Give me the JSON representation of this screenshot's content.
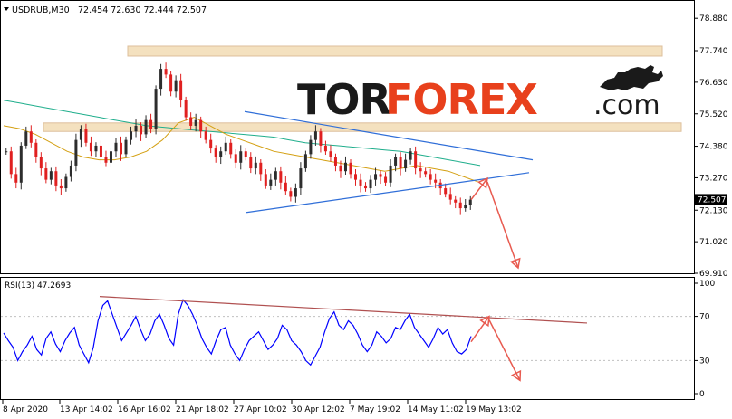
{
  "header": {
    "symbol": "USDRUB,M30",
    "ohlc": "72.454 72.630 72.444 72.507"
  },
  "watermark": {
    "part1": "TOR",
    "part2": "FOREX",
    "part3": ".com",
    "brand_color": "#e8401c",
    "dark_color": "#1a1a1a"
  },
  "indicator": {
    "label": "RSI(13) 47.2693"
  },
  "chart_data": [
    {
      "type": "candlestick",
      "ylim": [
        69.91,
        79.3
      ],
      "price_ticks": [
        "78.880",
        "77.740",
        "76.630",
        "75.520",
        "74.380",
        "73.270",
        "72.130",
        "71.020",
        "69.910"
      ],
      "price_tick_values": [
        78.88,
        77.74,
        76.63,
        75.52,
        74.38,
        73.27,
        72.13,
        71.02,
        69.91
      ],
      "current_price_label": "72.507",
      "current_price": 72.507,
      "x_labels": [
        "8 Apr 2020",
        "13 Apr 14:02",
        "16 Apr 16:02",
        "21 Apr 18:02",
        "27 Apr 10:02",
        "30 Apr 12:02",
        "7 May 19:02",
        "14 May 11:02",
        "19 May 13:02"
      ],
      "price_path": [
        74.2,
        73.4,
        73.1,
        74.4,
        74.9,
        74.5,
        74.0,
        73.6,
        73.2,
        73.5,
        73.0,
        72.9,
        73.3,
        73.7,
        74.6,
        75.0,
        74.5,
        74.2,
        74.4,
        74.0,
        73.8,
        74.2,
        74.5,
        74.1,
        74.6,
        74.9,
        75.1,
        74.8,
        75.3,
        75.0,
        76.4,
        77.1,
        76.9,
        76.3,
        76.7,
        76.0,
        75.4,
        75.1,
        75.3,
        74.9,
        74.6,
        74.3,
        74.0,
        74.2,
        74.5,
        74.1,
        73.8,
        74.2,
        74.0,
        73.6,
        73.8,
        73.4,
        73.0,
        73.2,
        73.5,
        73.1,
        72.8,
        72.6,
        72.9,
        73.6,
        74.1,
        74.6,
        74.9,
        74.4,
        74.2,
        74.0,
        73.7,
        73.5,
        73.8,
        73.4,
        73.2,
        73.0,
        72.9,
        73.2,
        73.4,
        73.3,
        73.1,
        73.7,
        74.0,
        73.6,
        73.9,
        74.2,
        73.6,
        73.5,
        73.4,
        73.2,
        73.1,
        72.9,
        72.7,
        72.5,
        72.4,
        72.2,
        72.3,
        72.5
      ],
      "moving_averages": [
        {
          "color": "#1fae8c",
          "values": [
            76.0,
            75.9,
            75.8,
            75.7,
            75.6,
            75.5,
            75.4,
            75.3,
            75.2,
            75.1,
            75.05,
            75.0,
            74.95,
            74.9,
            74.85,
            74.8,
            74.75,
            74.7,
            74.6,
            74.5,
            74.45,
            74.4,
            74.35,
            74.3,
            74.25,
            74.2,
            74.1,
            74.0,
            73.9,
            73.8,
            73.7
          ]
        },
        {
          "color": "#d4a013",
          "values": [
            75.1,
            75.0,
            74.8,
            74.5,
            74.2,
            74.0,
            73.9,
            73.9,
            74.0,
            74.2,
            74.6,
            75.2,
            75.4,
            75.1,
            74.8,
            74.6,
            74.4,
            74.2,
            74.1,
            74.0,
            73.9,
            73.8,
            73.7,
            73.6,
            73.5,
            73.6,
            73.7,
            73.6,
            73.5,
            73.3,
            73.1
          ]
        }
      ],
      "annotations": [
        {
          "kind": "resistance_zone",
          "y_low": 77.55,
          "y_high": 77.9
        },
        {
          "kind": "support_zone",
          "y_low": 74.9,
          "y_high": 75.2
        },
        {
          "kind": "trendline_upper",
          "from": 75.6,
          "to": 73.9
        },
        {
          "kind": "trendline_lower",
          "from": 72.05,
          "to": 73.45
        },
        {
          "kind": "forecast_up",
          "from": 72.5,
          "to": 73.25
        },
        {
          "kind": "forecast_down",
          "from": 73.25,
          "to": 70.1
        }
      ],
      "colors": {
        "bull": "#2d2d2d",
        "bear": "#e02020",
        "zone": "#f3dcb5",
        "trend": "#2f6ed8",
        "arrow": "#e85a4f"
      }
    },
    {
      "type": "line",
      "name": "RSI(13)",
      "ylim": [
        0,
        100
      ],
      "ticks": [
        "100",
        "70",
        "30",
        "0"
      ],
      "tick_values": [
        100,
        70,
        30,
        0
      ],
      "values": [
        55,
        48,
        42,
        30,
        38,
        44,
        52,
        40,
        35,
        50,
        56,
        45,
        38,
        48,
        55,
        60,
        44,
        36,
        28,
        42,
        66,
        80,
        84,
        72,
        60,
        48,
        55,
        62,
        70,
        58,
        48,
        54,
        66,
        72,
        62,
        50,
        44,
        72,
        85,
        80,
        72,
        62,
        50,
        42,
        36,
        48,
        58,
        60,
        44,
        36,
        30,
        40,
        48,
        52,
        56,
        48,
        40,
        44,
        50,
        62,
        58,
        48,
        44,
        38,
        30,
        26,
        34,
        42,
        56,
        68,
        74,
        62,
        58,
        66,
        62,
        54,
        44,
        38,
        44,
        56,
        52,
        46,
        50,
        60,
        58,
        66,
        72,
        60,
        54,
        48,
        42,
        50,
        60,
        54,
        58,
        46,
        38,
        36,
        40,
        52
      ],
      "trendline": {
        "from": 88,
        "to": 64
      },
      "forecast_up": {
        "from": 47,
        "to": 70
      },
      "forecast_down": {
        "from": 70,
        "to": 12
      },
      "colors": {
        "line": "#0000ff",
        "trend": "#b05050",
        "arrow": "#e85a4f"
      }
    }
  ]
}
